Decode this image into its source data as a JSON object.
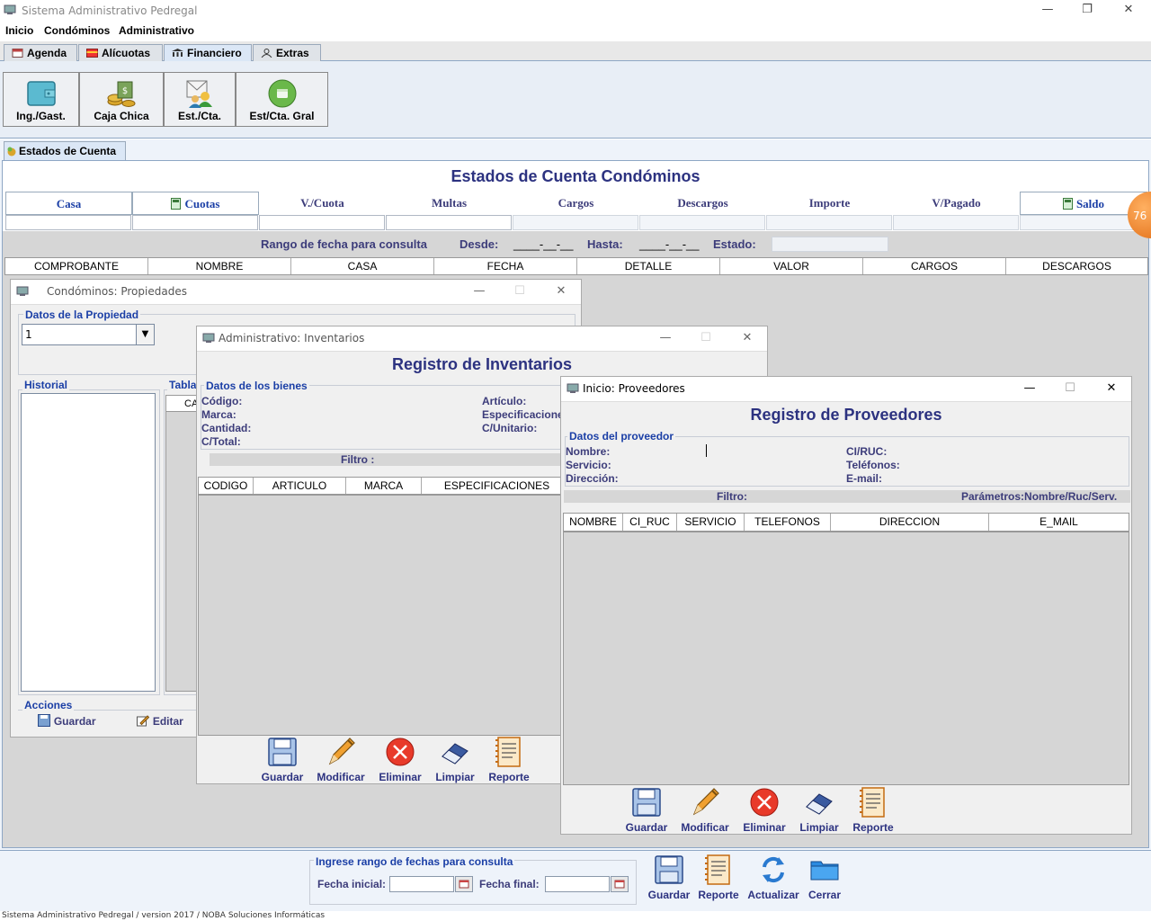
{
  "app": {
    "title": "Sistema Administrativo Pedregal",
    "window_controls": {
      "minimize": "—",
      "restore": "❐",
      "close": "✕"
    }
  },
  "menu": [
    "Inicio",
    "Condóminos",
    "Administrativo"
  ],
  "main_tabs": [
    {
      "label": "Agenda",
      "icon": "calendar-icon"
    },
    {
      "label": "Alícuotas",
      "icon": "card-icon"
    },
    {
      "label": "Financiero",
      "icon": "bank-icon"
    },
    {
      "label": "Extras",
      "icon": "user-icon"
    }
  ],
  "toolbar": [
    {
      "label": "Ing./Gast.",
      "icon": "wallet-icon"
    },
    {
      "label": "Caja Chica",
      "icon": "cash-icon"
    },
    {
      "label": "Est./Cta.",
      "icon": "statement-icon"
    },
    {
      "label": "Est/Cta. Gral",
      "icon": "general-statement-icon"
    }
  ],
  "sub_tab": "Estados de Cuenta",
  "estados": {
    "title": "Estados de Cuenta Condóminos",
    "columns": [
      "Casa",
      "Cuotas",
      "V./Cuota",
      "Multas",
      "Cargos",
      "Descargos",
      "Importe",
      "V/Pagado",
      "Saldo"
    ],
    "range": {
      "label": "Rango de fecha para consulta",
      "desde": "Desde:",
      "desde_val": "____-__-__",
      "hasta": "Hasta:",
      "hasta_val": "____-__-__",
      "estado": "Estado:"
    },
    "grid_headers": [
      "COMPROBANTE",
      "NOMBRE",
      "CASA",
      "FECHA",
      "DETALLE",
      "VALOR",
      "CARGOS",
      "DESCARGOS"
    ]
  },
  "badge": "76",
  "propiedades": {
    "title": "Condóminos: Propiedades",
    "datos_label": "Datos de la Propiedad",
    "select_value": "1",
    "historial": "Historial",
    "tabla": "Tabla",
    "tabla_col": "CA",
    "acciones": "Acciones",
    "guardar": "Guardar",
    "editar": "Editar"
  },
  "inventarios": {
    "title": "Administrativo: Inventarios",
    "heading": "Registro de  Inventarios",
    "group": "Datos de los bienes",
    "fields_left": [
      "Código:",
      "Marca:",
      "Cantidad:",
      "C/Total:"
    ],
    "fields_right": [
      "Artículo:",
      "Especificacione",
      "C/Unitario:"
    ],
    "filtro": "Filtro :",
    "grid_headers": [
      "CODIGO",
      "ARTICULO",
      "MARCA",
      "ESPECIFICACIONES"
    ],
    "actions": [
      "Guardar",
      "Modificar",
      "Eliminar",
      "Limpiar",
      "Reporte"
    ]
  },
  "proveedores": {
    "title": "Inicio: Proveedores",
    "heading": "Registro de  Proveedores",
    "group": "Datos del proveedor",
    "fields_left": [
      "Nombre:",
      "Servicio:",
      "Dirección:"
    ],
    "fields_right": [
      "CI/RUC:",
      "Teléfonos:",
      "E-mail:"
    ],
    "filtro": "Filtro:",
    "parametros": "Parámetros:Nombre/Ruc/Serv.",
    "grid_headers": [
      "NOMBRE",
      "CI_RUC",
      "SERVICIO",
      "TELEFONOS",
      "DIRECCION",
      "E_MAIL"
    ],
    "actions": [
      "Guardar",
      "Modificar",
      "Eliminar",
      "Limpiar",
      "Reporte"
    ]
  },
  "bottom": {
    "date_group": "Ingrese rango de fechas para consulta",
    "fecha_inicial": "Fecha inicial:",
    "fecha_final": "Fecha final:",
    "actions": [
      "Guardar",
      "Reporte",
      "Actualizar",
      "Cerrar"
    ]
  },
  "status": "Sistema Administrativo Pedregal / version 2017  / NOBA Soluciones Informáticas"
}
